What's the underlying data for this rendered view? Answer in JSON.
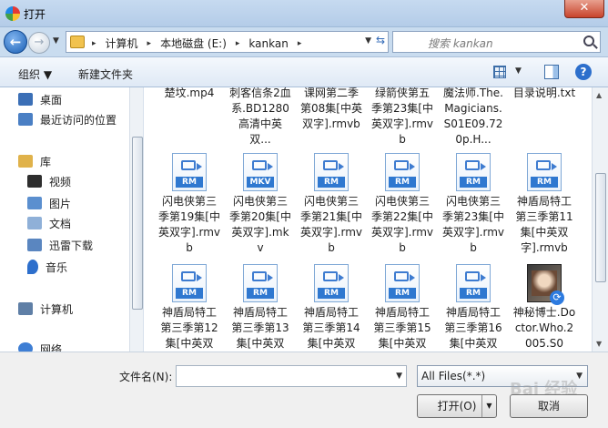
{
  "window": {
    "title": "打开",
    "close": "✕"
  },
  "nav": {
    "back": "←",
    "forward": "→",
    "history": "▼",
    "breadcrumb": [
      "计算机",
      "本地磁盘 (E:)",
      "kankan"
    ],
    "separator": "▸",
    "refresh": "⇆",
    "search_placeholder": "搜索 kankan"
  },
  "toolbar": {
    "organize": "组织 ▼",
    "new_folder": "新建文件夹"
  },
  "sidebar": {
    "items": [
      {
        "label": "桌面",
        "icon": "desktop-icon",
        "color": "#3b6fb6"
      },
      {
        "label": "最近访问的位置",
        "icon": "recent-places-icon",
        "color": "#4a7fc4"
      },
      {
        "label": "库",
        "icon": "library-icon",
        "color": "#e0b24a"
      },
      {
        "label": "视频",
        "icon": "video-icon",
        "color": "#2e2e2e"
      },
      {
        "label": "图片",
        "icon": "pictures-icon",
        "color": "#5b8fcf"
      },
      {
        "label": "文档",
        "icon": "documents-icon",
        "color": "#8fb0d8"
      },
      {
        "label": "迅雷下载",
        "icon": "download-icon",
        "color": "#5a86c0"
      },
      {
        "label": "音乐",
        "icon": "music-icon",
        "color": "#2d6fcc"
      },
      {
        "label": "计算机",
        "icon": "computer-icon",
        "color": "#5f7fa6"
      },
      {
        "label": "网络",
        "icon": "network-icon",
        "color": "#3e7ed4"
      }
    ]
  },
  "files": {
    "row1": [
      {
        "name": "楚坟.mp4"
      },
      {
        "name": "刺客信条2血系.BD1280高清中英双..."
      },
      {
        "name": "课网第二季第08集[中英双字].rmvb"
      },
      {
        "name": "绿箭侠第五季第23集[中英双字].rmvb"
      },
      {
        "name": "魔法师.The.Magicians.S01E09.720p.H..."
      },
      {
        "name": "目录说明.txt"
      }
    ],
    "row2": [
      {
        "name": "闪电侠第三季第19集[中英双字].rmvb",
        "badge": "RM"
      },
      {
        "name": "闪电侠第三季第20集[中英双字].mkv",
        "badge": "MKV"
      },
      {
        "name": "闪电侠第三季第21集[中英双字].rmvb",
        "badge": "RM"
      },
      {
        "name": "闪电侠第三季第22集[中英双字].rmvb",
        "badge": "RM"
      },
      {
        "name": "闪电侠第三季第23集[中英双字].rmvb",
        "badge": "RM"
      },
      {
        "name": "神盾局特工第三季第11集[中英双字].rmvb",
        "badge": "RM"
      }
    ],
    "row3": [
      {
        "name": "神盾局特工第三季第12集[中英双",
        "badge": "RM"
      },
      {
        "name": "神盾局特工第三季第13集[中英双",
        "badge": "RM"
      },
      {
        "name": "神盾局特工第三季第14集[中英双",
        "badge": "RM"
      },
      {
        "name": "神盾局特工第三季第15集[中英双",
        "badge": "RM"
      },
      {
        "name": "神盾局特工第三季第16集[中英双",
        "badge": "RM"
      },
      {
        "name": "神秘博士.Doctor.Who.2005.S0",
        "badge": ""
      }
    ]
  },
  "bottom": {
    "filename_label": "文件名(N):",
    "filename_value": "",
    "filter": "All Files(*.*)",
    "open": "打开(O)",
    "cancel": "取消",
    "watermark": "Bai 经验"
  }
}
